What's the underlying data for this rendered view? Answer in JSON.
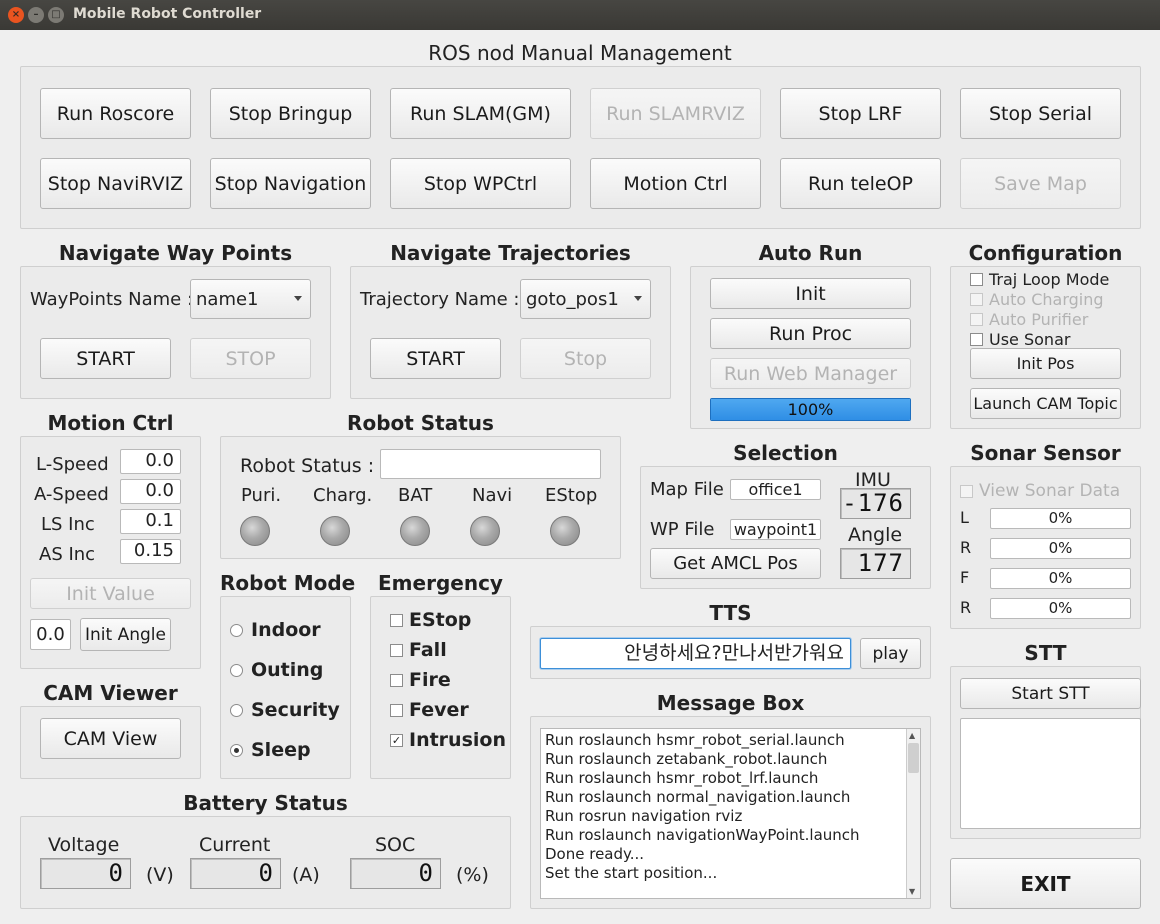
{
  "window": {
    "title": "Mobile Robot Controller"
  },
  "ros": {
    "heading": "ROS nod Manual Management",
    "buttons": [
      "Run Roscore",
      "Stop Bringup",
      "Run SLAM(GM)",
      "Run SLAMRVIZ",
      "Stop LRF",
      "Stop Serial",
      "Stop NaviRVIZ",
      "Stop Navigation",
      "Stop WPCtrl",
      "Motion Ctrl",
      "Run teleOP",
      "Save Map"
    ]
  },
  "waypoints": {
    "heading": "Navigate Way Points",
    "name_label": "WayPoints Name :",
    "selected": "name1",
    "start": "START",
    "stop": "STOP"
  },
  "trajectories": {
    "heading": "Navigate Trajectories",
    "name_label": "Trajectory Name :",
    "selected": "goto_pos1",
    "start": "START",
    "stop": "Stop"
  },
  "autorun": {
    "heading": "Auto Run",
    "init": "Init",
    "run_proc": "Run Proc",
    "web_manager": "Run Web Manager",
    "progress_text": "100%",
    "progress": 1.0
  },
  "config": {
    "heading": "Configuration",
    "traj_loop": "Traj Loop Mode",
    "auto_charging": "Auto Charging",
    "auto_purifier": "Auto Purifier",
    "use_sonar": "Use Sonar",
    "init_pos": "Init Pos",
    "launch_cam": "Launch CAM Topic"
  },
  "motion": {
    "heading": "Motion Ctrl",
    "l_speed_label": "L-Speed",
    "l_speed": "0.0",
    "a_speed_label": "A-Speed",
    "a_speed": "0.0",
    "ls_inc_label": "LS Inc",
    "ls_inc": "0.1",
    "as_inc_label": "AS Inc",
    "as_inc": "0.15",
    "init_value": "Init Value",
    "angle_value": "0.0",
    "init_angle": "Init Angle"
  },
  "robot_status": {
    "heading": "Robot Status",
    "label": "Robot Status :",
    "value": "",
    "indicators": [
      "Puri.",
      "Charg.",
      "BAT",
      "Navi",
      "EStop"
    ]
  },
  "selection": {
    "heading": "Selection",
    "map_label": "Map File",
    "map_value": "office1",
    "wp_label": "WP File",
    "wp_value": "waypoint1",
    "amcl": "Get AMCL Pos",
    "imu_label": "IMU",
    "imu_value": "-176",
    "angle_label": "Angle",
    "angle_value": "177"
  },
  "sonar": {
    "heading": "Sonar Sensor",
    "view": "View Sonar Data",
    "rows": [
      {
        "label": "L",
        "value": "0%"
      },
      {
        "label": "R",
        "value": "0%"
      },
      {
        "label": "F",
        "value": "0%"
      },
      {
        "label": "R",
        "value": "0%"
      }
    ]
  },
  "robot_mode": {
    "heading": "Robot Mode",
    "options": [
      "Indoor",
      "Outing",
      "Security",
      "Sleep"
    ],
    "selected_index": 3
  },
  "emergency": {
    "heading": "Emergency",
    "items": [
      "EStop",
      "Fall",
      "Fire",
      "Fever",
      "Intrusion"
    ],
    "checked": [
      false,
      false,
      false,
      false,
      true
    ]
  },
  "tts": {
    "heading": "TTS",
    "text": "안녕하세요?만나서반가워요",
    "play": "play"
  },
  "stt": {
    "heading": "STT",
    "start": "Start STT"
  },
  "cam": {
    "heading": "CAM Viewer",
    "view": "CAM View"
  },
  "messages": {
    "heading": "Message Box",
    "lines": [
      "Run roslaunch hsmr_robot_serial.launch",
      "Run roslaunch zetabank_robot.launch",
      "Run roslaunch hsmr_robot_lrf.launch",
      "Run roslaunch normal_navigation.launch",
      "Run rosrun navigation rviz",
      "Run roslaunch navigationWayPoint.launch",
      "Done ready...",
      "Set the start position..."
    ]
  },
  "battery": {
    "heading": "Battery Status",
    "voltage_label": "Voltage",
    "voltage": "0",
    "voltage_unit": "(V)",
    "current_label": "Current",
    "current": "0",
    "current_unit": "(A)",
    "soc_label": "SOC",
    "soc": "0",
    "soc_unit": "(%)"
  },
  "exit": "EXIT",
  "colors": {
    "progress": "#2f8ee5",
    "title_bar": "#3c3b37",
    "close_button": "#e95420"
  }
}
